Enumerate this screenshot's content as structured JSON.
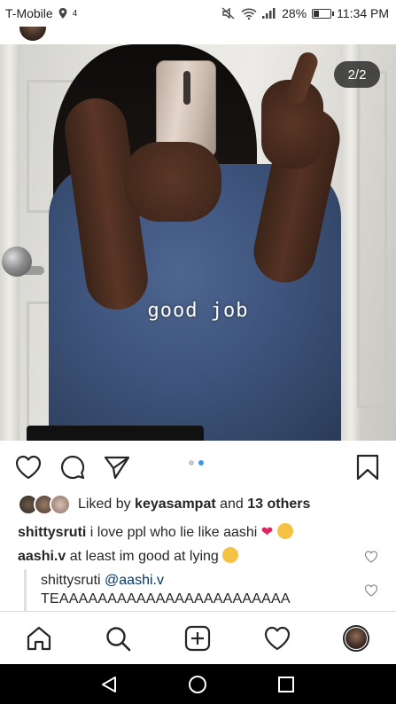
{
  "status_bar": {
    "carrier": "T-Mobile",
    "signal_extra": "4",
    "battery_percent_label": "28%",
    "battery_level": 0.28,
    "time": "11:34 PM"
  },
  "post": {
    "carousel": {
      "counter": "2/2",
      "current": 2,
      "total": 2
    },
    "overlay_text": "good job",
    "likes": {
      "prefix": "Liked by",
      "user": "keyasampat",
      "joiner": "and",
      "others": "13 others"
    },
    "comments": [
      {
        "user": "shittysruti",
        "text": "i love ppl who lie like aashi"
      },
      {
        "user": "aashi.v",
        "text": "at least im good at lying"
      }
    ],
    "reply": {
      "user": "shittysruti",
      "mention": "@aashi.v",
      "text": "TEAAAAAAAAAAAAAAAAAAAAAAAA"
    }
  },
  "icons": {
    "like": "heart-icon",
    "comment": "comment-icon",
    "share": "send-icon",
    "save": "bookmark-icon",
    "home": "home-icon",
    "search": "search-icon",
    "new_post": "add-post-icon",
    "activity": "heart-icon",
    "profile": "profile-avatar"
  },
  "colors": {
    "text": "#262626",
    "link": "#003569",
    "carousel_active": "#3897f0",
    "heart_emoji": "#e0245e"
  }
}
